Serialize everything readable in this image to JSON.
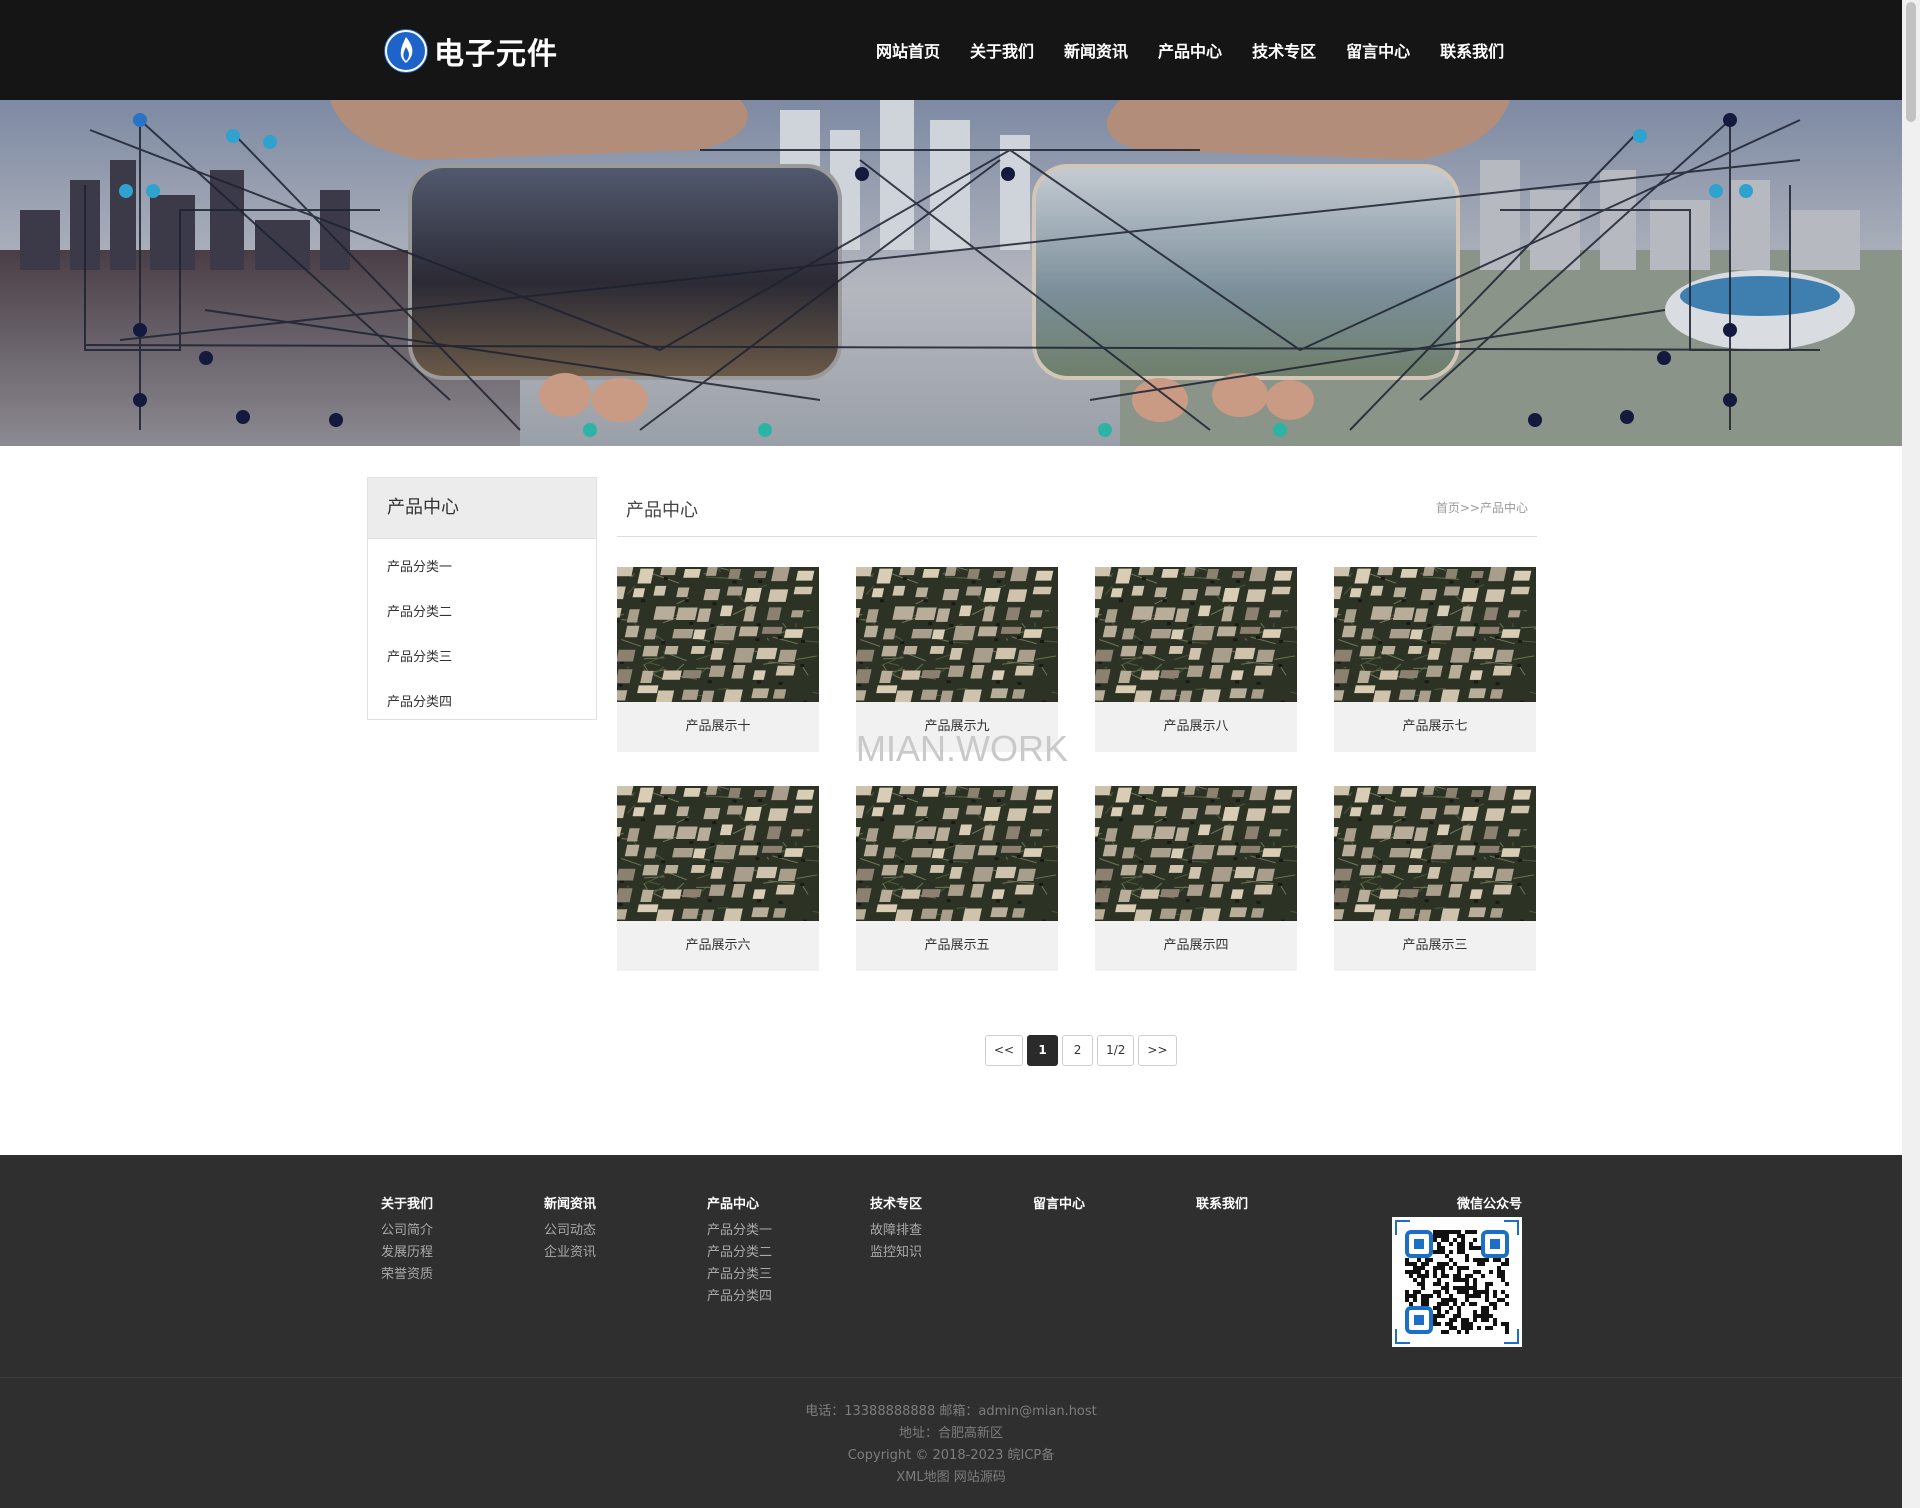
{
  "brand": {
    "name": "电子元件",
    "accent": "#1e63c9"
  },
  "nav": {
    "items": [
      "网站首页",
      "关于我们",
      "新闻资讯",
      "产品中心",
      "技术专区",
      "留言中心",
      "联系我们"
    ]
  },
  "sidebar": {
    "title": "产品中心",
    "items": [
      "产品分类一",
      "产品分类二",
      "产品分类三",
      "产品分类四"
    ]
  },
  "main": {
    "title": "产品中心",
    "breadcrumb": {
      "home": "首页",
      "sep": ">>",
      "current": "产品中心"
    },
    "products": [
      "产品展示十",
      "产品展示九",
      "产品展示八",
      "产品展示七",
      "产品展示六",
      "产品展示五",
      "产品展示四",
      "产品展示三"
    ]
  },
  "watermark": "MIAN.WORK",
  "pagination": {
    "prev": "<<",
    "pages": [
      "1",
      "2"
    ],
    "active": "1",
    "info": "1/2",
    "next": ">>"
  },
  "footer": {
    "columns": [
      {
        "title": "关于我们",
        "links": [
          "公司简介",
          "发展历程",
          "荣誉资质"
        ]
      },
      {
        "title": "新闻资讯",
        "links": [
          "公司动态",
          "企业资讯"
        ]
      },
      {
        "title": "产品中心",
        "links": [
          "产品分类一",
          "产品分类二",
          "产品分类三",
          "产品分类四"
        ]
      },
      {
        "title": "技术专区",
        "links": [
          "故障排查",
          "监控知识"
        ]
      },
      {
        "title": "留言中心",
        "links": []
      },
      {
        "title": "联系我们",
        "links": []
      }
    ],
    "wechat_title": "微信公众号",
    "phone": "电话：13388888888 邮箱：admin@mian.host",
    "address": "地址：合肥高新区",
    "copyright": "Copyright © 2018-2023 皖ICP备",
    "sitemap": "XML地图",
    "source": "网站源码"
  }
}
